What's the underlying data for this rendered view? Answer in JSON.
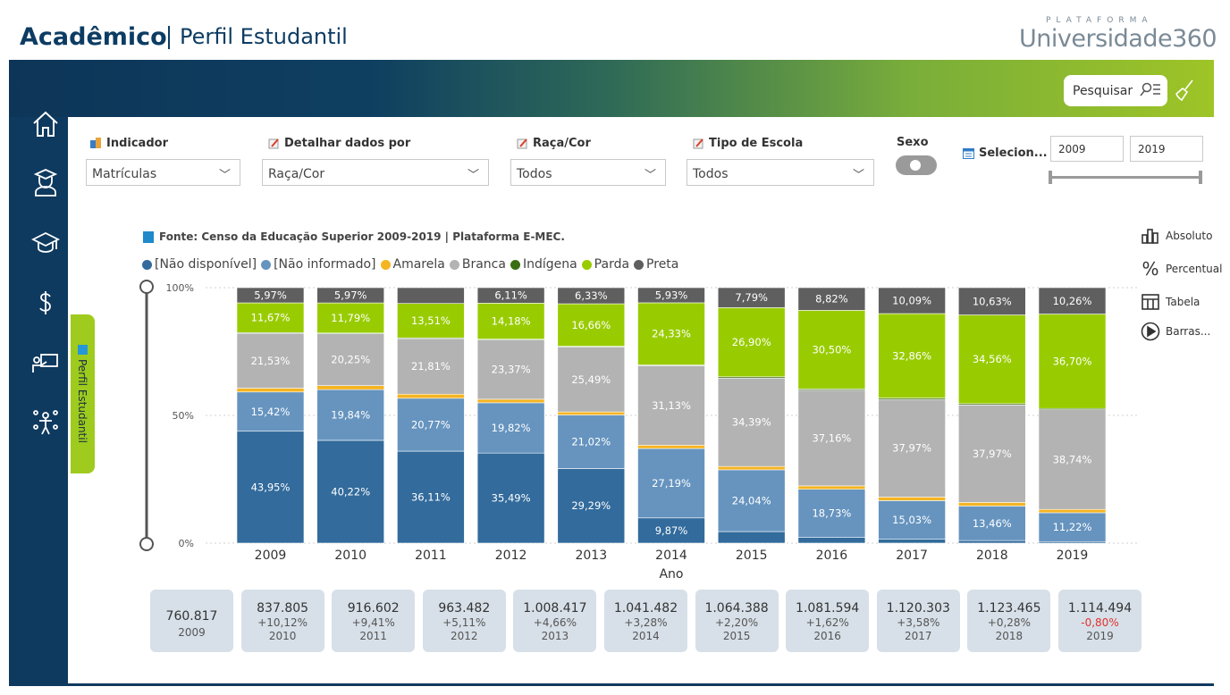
{
  "header": {
    "title": "Acadêmico",
    "subtitle": "Perfil Estudantil"
  },
  "logo": {
    "top": "PLATAFORMA",
    "name": "Universidade360"
  },
  "toolbar": {
    "search_label": "Pesquisar"
  },
  "side_tab": {
    "label": "Perfil Estudantil"
  },
  "filters": {
    "indicador": {
      "label": "Indicador",
      "value": "Matrículas"
    },
    "detalhar": {
      "label": "Detalhar dados por",
      "value": "Raça/Cor"
    },
    "raca": {
      "label": "Raça/Cor",
      "value": "Todos"
    },
    "escola": {
      "label": "Tipo de Escola",
      "value": "Todos"
    },
    "sexo": {
      "label": "Sexo"
    },
    "periodo": {
      "label": "Selecion...",
      "from": "2009",
      "to": "2019"
    }
  },
  "source": "Fonte: Censo da Educação Superior 2009-2019 | Plataforma E-MEC.",
  "right_menu": {
    "absoluto": "Absoluto",
    "percentual": "Percentual",
    "tabela": "Tabela",
    "barras": "Barras..."
  },
  "chart_data": {
    "type": "bar",
    "stacked": true,
    "xlabel": "Ano",
    "y_ticks": [
      "0%",
      "50%",
      "100%"
    ],
    "ylim": [
      0,
      100
    ],
    "categories": [
      "2009",
      "2010",
      "2011",
      "2012",
      "2013",
      "2014",
      "2015",
      "2016",
      "2017",
      "2018",
      "2019"
    ],
    "series": [
      {
        "name": "[Não disponível]",
        "color": "#326b9c",
        "values": [
          43.95,
          40.22,
          36.11,
          35.49,
          29.29,
          9.87,
          4.5,
          2.2,
          1.5,
          1.0,
          0.6
        ],
        "labels": [
          "43,95%",
          "40,22%",
          "36,11%",
          "35,49%",
          "29,29%",
          "9,87%",
          "",
          "",
          "",
          "",
          ""
        ]
      },
      {
        "name": "[Não informado]",
        "color": "#6694bf",
        "values": [
          15.42,
          19.84,
          20.77,
          19.82,
          21.02,
          27.19,
          24.04,
          18.73,
          15.03,
          13.46,
          11.22
        ],
        "labels": [
          "15,42%",
          "19,84%",
          "20,77%",
          "19,82%",
          "21,02%",
          "27,19%",
          "24,04%",
          "18,73%",
          "15,03%",
          "13,46%",
          "11,22%"
        ]
      },
      {
        "name": "Amarela",
        "color": "#f5b422",
        "values": [
          1.5,
          1.6,
          1.6,
          1.4,
          1.2,
          1.3,
          1.3,
          1.3,
          1.4,
          1.4,
          1.3
        ],
        "labels": [
          "",
          "",
          "",
          "",
          "",
          "",
          "",
          "",
          "",
          "",
          ""
        ]
      },
      {
        "name": "Branca",
        "color": "#b3b3b3",
        "values": [
          21.53,
          20.25,
          21.81,
          23.37,
          25.49,
          31.13,
          34.39,
          37.16,
          37.97,
          37.97,
          38.74
        ],
        "labels": [
          "21,53%",
          "20,25%",
          "21,81%",
          "23,37%",
          "25,49%",
          "31,13%",
          "34,39%",
          "37,16%",
          "37,97%",
          "37,97%",
          "38,74%"
        ]
      },
      {
        "name": "Indígena",
        "color": "#3a6e12",
        "values": [
          0.3,
          0.3,
          0.3,
          0.3,
          0.3,
          0.3,
          0.5,
          0.5,
          0.5,
          0.5,
          0.5
        ],
        "labels": [
          "",
          "",
          "",
          "",
          "",
          "",
          "",
          "",
          "",
          "",
          ""
        ]
      },
      {
        "name": "Parda",
        "color": "#99cc00",
        "values": [
          11.67,
          11.79,
          13.51,
          14.18,
          16.66,
          24.33,
          26.9,
          30.5,
          32.86,
          34.56,
          36.7
        ],
        "labels": [
          "11,67%",
          "11,79%",
          "13,51%",
          "14,18%",
          "16,66%",
          "24,33%",
          "26,90%",
          "30,50%",
          "32,86%",
          "34,56%",
          "36,70%"
        ]
      },
      {
        "name": "Preta",
        "color": "#5f5f5f",
        "values": [
          5.97,
          5.97,
          6.2,
          6.11,
          6.33,
          5.93,
          7.79,
          8.82,
          10.09,
          10.63,
          10.26
        ],
        "labels": [
          "5,97%",
          "5,97%",
          "",
          "6,11%",
          "6,33%",
          "5,93%",
          "7,79%",
          "8,82%",
          "10,09%",
          "10,63%",
          "10,26%"
        ]
      }
    ]
  },
  "cards": [
    {
      "value": "760.817",
      "pct": "",
      "year": "2009",
      "neg": false
    },
    {
      "value": "837.805",
      "pct": "+10,12%",
      "year": "2010",
      "neg": false
    },
    {
      "value": "916.602",
      "pct": "+9,41%",
      "year": "2011",
      "neg": false
    },
    {
      "value": "963.482",
      "pct": "+5,11%",
      "year": "2012",
      "neg": false
    },
    {
      "value": "1.008.417",
      "pct": "+4,66%",
      "year": "2013",
      "neg": false
    },
    {
      "value": "1.041.482",
      "pct": "+3,28%",
      "year": "2014",
      "neg": false
    },
    {
      "value": "1.064.388",
      "pct": "+2,20%",
      "year": "2015",
      "neg": false
    },
    {
      "value": "1.081.594",
      "pct": "+1,62%",
      "year": "2016",
      "neg": false
    },
    {
      "value": "1.120.303",
      "pct": "+3,58%",
      "year": "2017",
      "neg": false
    },
    {
      "value": "1.123.465",
      "pct": "+0,28%",
      "year": "2018",
      "neg": false
    },
    {
      "value": "1.114.494",
      "pct": "-0,80%",
      "year": "2019",
      "neg": true
    }
  ]
}
